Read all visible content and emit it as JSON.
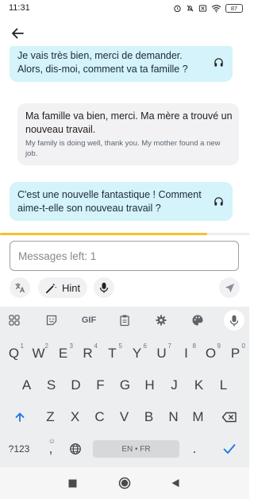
{
  "status_bar": {
    "time": "11:31",
    "battery": "87"
  },
  "messages": [
    {
      "role": "tutor",
      "text": "Je vais très bien, merci de demander. Alors, dis-moi, comment va ta famille ?"
    },
    {
      "role": "user",
      "text": "Ma famille va bien, merci. Ma mère a trouvé un nouveau travail.",
      "translation": "My family is doing well, thank you. My mother found a new job."
    },
    {
      "role": "tutor",
      "text": "C'est une nouvelle fantastique ! Comment aime-t-elle son nouveau travail ?"
    }
  ],
  "progress": {
    "fraction": 0.83,
    "color": "#f2c12e"
  },
  "composer": {
    "placeholder": "Messages left: 1",
    "hint_label": "Hint"
  },
  "keyboard": {
    "toolbar": [
      "apps-grid-icon",
      "sticker-icon",
      "GIF",
      "clipboard-icon",
      "settings-icon",
      "palette-icon",
      "mic-icon"
    ],
    "row1": [
      {
        "key": "Q",
        "sup": "1"
      },
      {
        "key": "W",
        "sup": "2"
      },
      {
        "key": "E",
        "sup": "3"
      },
      {
        "key": "R",
        "sup": "4"
      },
      {
        "key": "T",
        "sup": "5"
      },
      {
        "key": "Y",
        "sup": "6"
      },
      {
        "key": "U",
        "sup": "7"
      },
      {
        "key": "I",
        "sup": "8"
      },
      {
        "key": "O",
        "sup": "9"
      },
      {
        "key": "P",
        "sup": "0"
      }
    ],
    "row2": [
      "A",
      "S",
      "D",
      "F",
      "G",
      "H",
      "J",
      "K",
      "L"
    ],
    "row3": [
      "Z",
      "X",
      "C",
      "V",
      "B",
      "N",
      "M"
    ],
    "symbols_label": "?123",
    "comma_label": ",",
    "period_label": ".",
    "space_label": "EN • FR"
  },
  "colors": {
    "tutor_bubble": "#d4f3fb",
    "user_bubble": "#f2f2f4",
    "accent_blue": "#1a73e8"
  }
}
